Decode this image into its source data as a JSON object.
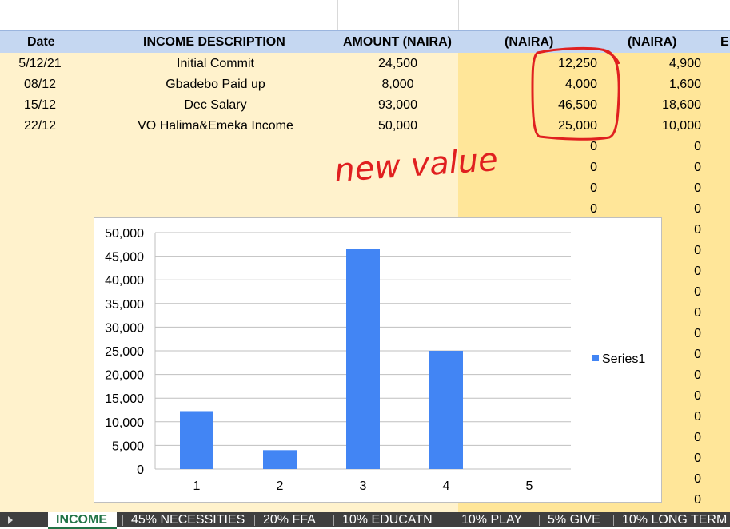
{
  "sheet": {
    "headers": [
      "Date",
      "INCOME DESCRIPTION",
      "AMOUNT (NAIRA)",
      "(NAIRA)",
      "(NAIRA)",
      "E"
    ],
    "rows": [
      {
        "date": "5/12/21",
        "desc": "Initial Commit",
        "amount": "24,500",
        "col4": "12,250",
        "col5": "4,900"
      },
      {
        "date": "08/12",
        "desc": "Gbadebo Paid up",
        "amount": "8,000",
        "col4": "4,000",
        "col5": "1,600"
      },
      {
        "date": "15/12",
        "desc": "Dec Salary",
        "amount": "93,000",
        "col4": "46,500",
        "col5": "18,600"
      },
      {
        "date": "22/12",
        "desc": "VO Halima&Emeka Income",
        "amount": "50,000",
        "col4": "25,000",
        "col5": "10,000"
      }
    ],
    "zero_value": "0",
    "zero_rows_col4": 18,
    "zero_rows_col5": 18,
    "colors": {
      "header_bg": "#c5d7f1",
      "light_fill": "#fff2cc",
      "dark_fill": "#ffe699",
      "annotation": "#e02020"
    }
  },
  "annotation": {
    "text": "new value"
  },
  "chart_data": {
    "type": "bar",
    "categories": [
      "1",
      "2",
      "3",
      "4",
      "5"
    ],
    "series": [
      {
        "name": "Series1",
        "values": [
          12250,
          4000,
          46500,
          25000,
          0
        ],
        "color": "#4285f4"
      }
    ],
    "ylim": [
      0,
      50000
    ],
    "yticks": [
      "0",
      "5,000",
      "10,000",
      "15,000",
      "20,000",
      "25,000",
      "30,000",
      "35,000",
      "40,000",
      "45,000",
      "50,000"
    ],
    "grid": true,
    "legend": "right"
  },
  "tabs": {
    "arrow_icon": "play-arrow-icon",
    "items": [
      "INCOME",
      "45% NECESSITIES",
      "20% FFA",
      "10% EDUCATN",
      "10% PLAY",
      "5% GIVE",
      "10% LONG TERM"
    ],
    "active": "INCOME"
  }
}
